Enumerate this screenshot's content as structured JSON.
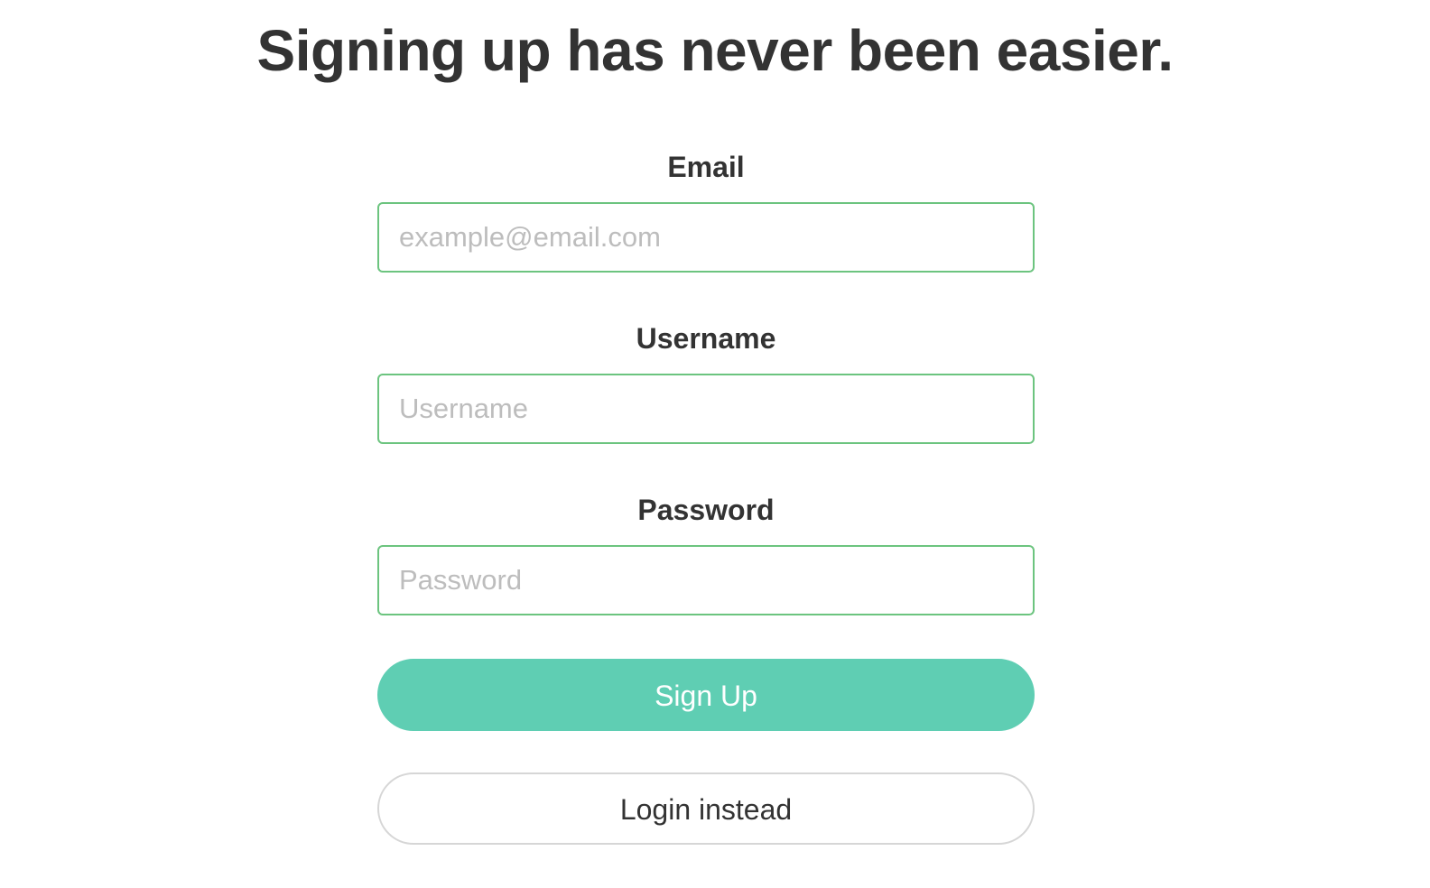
{
  "page": {
    "title": "Signing up has never been easier."
  },
  "form": {
    "email": {
      "label": "Email",
      "placeholder": "example@email.com",
      "value": ""
    },
    "username": {
      "label": "Username",
      "placeholder": "Username",
      "value": ""
    },
    "password": {
      "label": "Password",
      "placeholder": "Password",
      "value": ""
    },
    "signup_label": "Sign Up",
    "login_label": "Login instead"
  },
  "colors": {
    "input_border": "#6cc47f",
    "primary_button": "#5fceb3",
    "secondary_border": "#d6d6d6",
    "text": "#333333",
    "placeholder": "#bdbdbd"
  }
}
